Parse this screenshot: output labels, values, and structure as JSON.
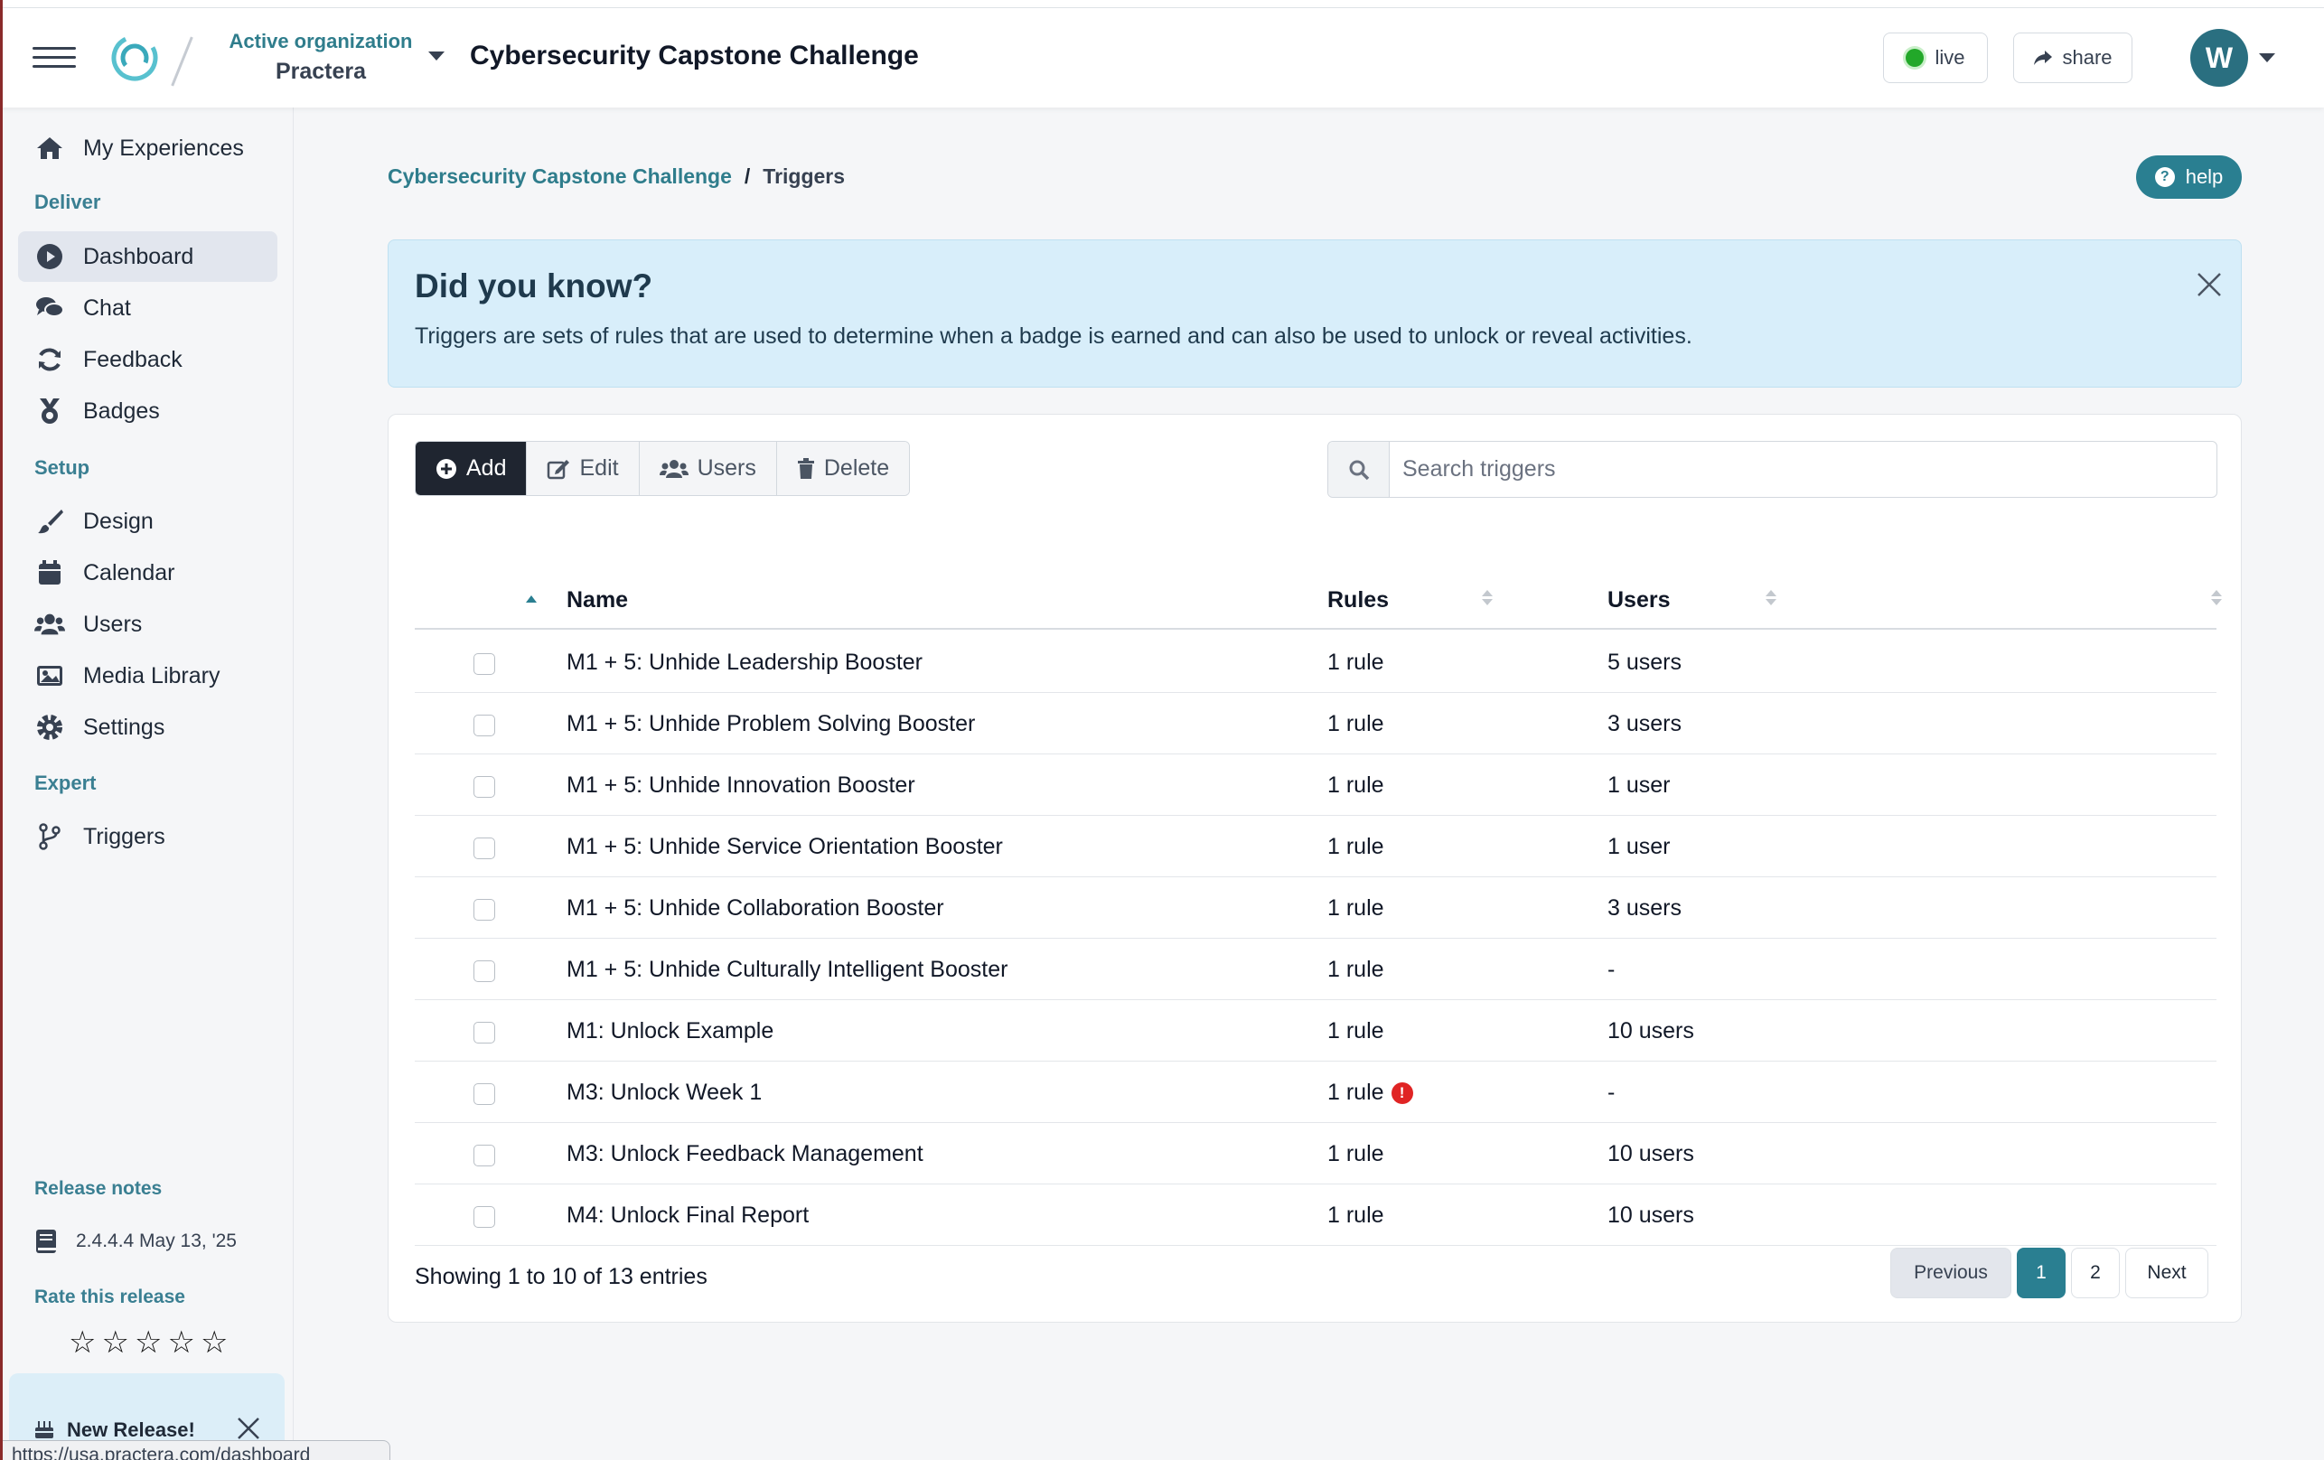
{
  "header": {
    "org_label": "Active organization",
    "org_name": "Practera",
    "experience_title": "Cybersecurity Capstone Challenge",
    "live_label": "live",
    "share_label": "share",
    "avatar_initial": "W"
  },
  "sidebar": {
    "my_experiences": "My Experiences",
    "section_deliver": "Deliver",
    "deliver_items": [
      "Dashboard",
      "Chat",
      "Feedback",
      "Badges"
    ],
    "section_setup": "Setup",
    "setup_items": [
      "Design",
      "Calendar",
      "Users",
      "Media Library",
      "Settings"
    ],
    "section_expert": "Expert",
    "expert_items": [
      "Triggers"
    ],
    "release_notes_label": "Release notes",
    "version_text": "2.4.4.4 May 13, '25",
    "rate_label": "Rate this release",
    "new_release_label": "New Release!",
    "status_url": "https://usa.practera.com/dashboard"
  },
  "breadcrumb": {
    "parent": "Cybersecurity Capstone Challenge",
    "separator": "/",
    "current": "Triggers"
  },
  "help_label": "help",
  "info": {
    "title": "Did you know?",
    "text": "Triggers are sets of rules that are used to determine when a badge is earned and can also be used to unlock or reveal activities."
  },
  "toolbar": {
    "add": "Add",
    "edit": "Edit",
    "users": "Users",
    "delete": "Delete"
  },
  "search": {
    "placeholder": "Search triggers"
  },
  "table": {
    "columns": {
      "name": "Name",
      "rules": "Rules",
      "users": "Users"
    },
    "rows": [
      {
        "name": "M1 + 5: Unhide Leadership Booster",
        "rules": "1 rule",
        "users": "5 users",
        "warning": false
      },
      {
        "name": "M1 + 5: Unhide Problem Solving Booster",
        "rules": "1 rule",
        "users": "3 users",
        "warning": false
      },
      {
        "name": "M1 + 5: Unhide Innovation Booster",
        "rules": "1 rule",
        "users": "1 user",
        "warning": false
      },
      {
        "name": "M1 + 5: Unhide Service Orientation Booster",
        "rules": "1 rule",
        "users": "1 user",
        "warning": false
      },
      {
        "name": "M1 + 5: Unhide Collaboration Booster",
        "rules": "1 rule",
        "users": "3 users",
        "warning": false
      },
      {
        "name": "M1 + 5: Unhide Culturally Intelligent Booster",
        "rules": "1 rule",
        "users": "-",
        "warning": false
      },
      {
        "name": "M1: Unlock Example",
        "rules": "1 rule",
        "users": "10 users",
        "warning": false
      },
      {
        "name": "M3: Unlock Week 1",
        "rules": "1 rule",
        "users": "-",
        "warning": true
      },
      {
        "name": "M3: Unlock Feedback Management",
        "rules": "1 rule",
        "users": "10 users",
        "warning": false
      },
      {
        "name": "M4: Unlock Final Report",
        "rules": "1 rule",
        "users": "10 users",
        "warning": false
      }
    ]
  },
  "footer": {
    "showing": "Showing 1 to 10 of 13 entries",
    "previous": "Previous",
    "pages": [
      "1",
      "2"
    ],
    "next": "Next"
  },
  "colors": {
    "accent": "#2a7f91",
    "dark_button": "#1f2530",
    "info_bg": "#d8eefa",
    "live_dot": "#22a829",
    "warning": "#e02424"
  }
}
